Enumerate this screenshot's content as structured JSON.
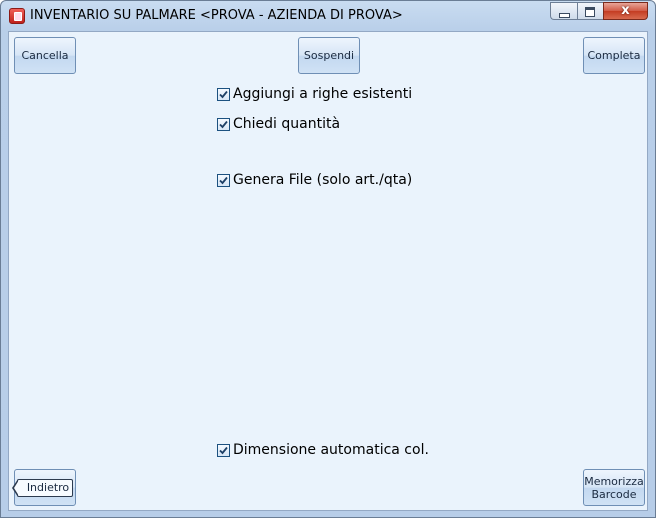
{
  "window": {
    "title": "INVENTARIO SU PALMARE <PROVA - AZIENDA DI PROVA>",
    "close_glyph": "x"
  },
  "toolbar": {
    "cancel_label": "Cancella",
    "suspend_label": "Sospendi",
    "complete_label": "Completa"
  },
  "options": [
    {
      "label": "Aggiungi a righe esistenti",
      "checked": true
    },
    {
      "label": "Chiedi quantità",
      "checked": true
    },
    {
      "label": "Genera File (solo art./qta)",
      "checked": true
    },
    {
      "label": "Dimensione automatica col.",
      "checked": true
    }
  ],
  "footer": {
    "back_label": "Indietro",
    "save_barcode_line1": "Memorizza",
    "save_barcode_line2": "Barcode"
  },
  "colors": {
    "client_bg": "#eaf3fc",
    "frame": "#b9cfe9",
    "close_button": "#c43c22"
  }
}
